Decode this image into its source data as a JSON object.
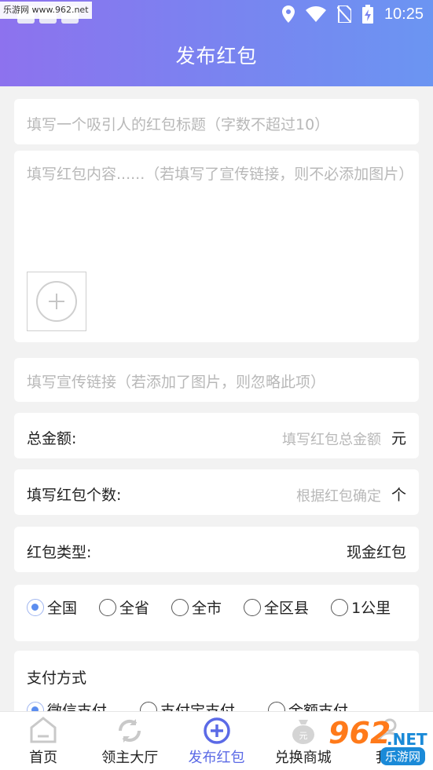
{
  "status_bar": {
    "watermark": "乐游网 www.962.net",
    "time": "10:25"
  },
  "header": {
    "title": "发布红包"
  },
  "form": {
    "title_placeholder": "填写一个吸引人的红包标题（字数不超过10）",
    "content_placeholder": "填写红包内容......（若填写了宣传链接，则不必添加图片）",
    "link_placeholder": "填写宣传链接（若添加了图片，则忽略此项）",
    "amount": {
      "label": "总金额:",
      "placeholder": "填写红包总金额",
      "unit": "元"
    },
    "count": {
      "label": "填写红包个数:",
      "placeholder": "根据红包确定",
      "unit": "个"
    },
    "type": {
      "label": "红包类型:",
      "value": "现金红包"
    },
    "region": {
      "options": [
        "全国",
        "全省",
        "全市",
        "全区县",
        "1公里"
      ],
      "selected": "全国"
    },
    "payment": {
      "label": "支付方式",
      "options": [
        "微信支付",
        "支付宝支付",
        "余额支付"
      ],
      "selected": "微信支付"
    }
  },
  "bottom_nav": {
    "items": [
      {
        "label": "首页",
        "icon": "home-icon"
      },
      {
        "label": "领主大厅",
        "icon": "refresh-icon"
      },
      {
        "label": "发布红包",
        "icon": "plus-circle-icon"
      },
      {
        "label": "兑换商城",
        "icon": "money-bag-icon"
      },
      {
        "label": "我的",
        "icon": "user-icon"
      }
    ],
    "active": "发布红包"
  },
  "watermark": {
    "number": "962",
    "net": ".NET",
    "text": "乐游网"
  },
  "colors": {
    "header_gradient_start": "#8d72ee",
    "header_gradient_end": "#6b95f2",
    "active_nav": "#5b6ae6",
    "radio_checked": "#5b8def"
  }
}
